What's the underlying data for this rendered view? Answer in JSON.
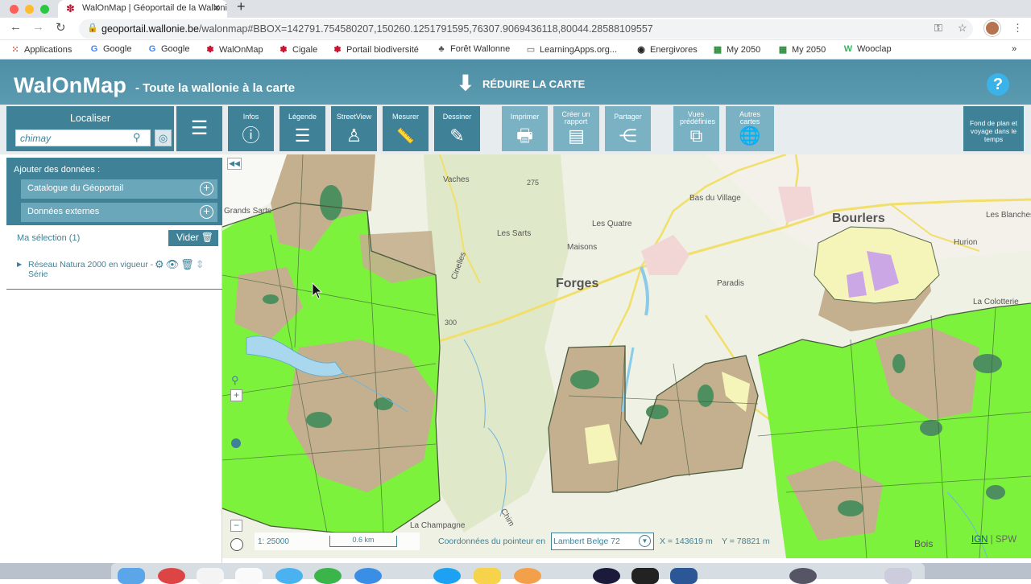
{
  "browser": {
    "tab_title": "WalOnMap | Géoportail de la Wallonie",
    "url_host": "geoportail.wallonie.be",
    "url_path": "/walonmap#BBOX=142791.754580207,150260.1251791595,76307.9069436118,80044.28588109557",
    "bookmarks": [
      {
        "icon": "grid",
        "label": "Applications"
      },
      {
        "icon": "G",
        "label": "Google"
      },
      {
        "icon": "G",
        "label": "Google"
      },
      {
        "icon": "dragon",
        "label": "WalOnMap"
      },
      {
        "icon": "dragon",
        "label": "Cigale"
      },
      {
        "icon": "dragon",
        "label": "Portail biodiversité"
      },
      {
        "icon": "tree",
        "label": "Forêt Wallonne"
      },
      {
        "icon": "doc",
        "label": "LearningApps.org..."
      },
      {
        "icon": "globe",
        "label": "Energivores"
      },
      {
        "icon": "grid2050",
        "label": "My 2050"
      },
      {
        "icon": "grid2050",
        "label": "My 2050"
      },
      {
        "icon": "W",
        "label": "Wooclap"
      }
    ],
    "bookmarks_more": "»"
  },
  "app": {
    "logo": "WalOnMap",
    "logo_sub": "- Toute la wallonie à la carte",
    "reduce_label": "RÉDUIRE LA CARTE",
    "help_label": "?"
  },
  "toolbar": {
    "localiser_title": "Localiser",
    "search_value": "chimay",
    "buttons": [
      {
        "id": "infos",
        "label": "Infos",
        "icon": "ⓘ"
      },
      {
        "id": "legende",
        "label": "Légende",
        "icon": "☰"
      },
      {
        "id": "streetview",
        "label": "StreetView",
        "icon": "♙"
      },
      {
        "id": "mesurer",
        "label": "Mesurer",
        "icon": "📏"
      },
      {
        "id": "dessiner",
        "label": "Dessiner",
        "icon": "✎"
      },
      {
        "id": "imprimer",
        "label": "Imprimer",
        "icon": "🖶"
      },
      {
        "id": "rapport",
        "label": "Créer un rapport",
        "icon": "▤"
      },
      {
        "id": "partager",
        "label": "Partager",
        "icon": "⋲"
      },
      {
        "id": "vues",
        "label": "Vues prédéfinies",
        "icon": "⧉"
      },
      {
        "id": "autres",
        "label": "Autres cartes",
        "icon": "🌐"
      }
    ],
    "fond_label": "Fond de plan et voyage dans le temps"
  },
  "panel": {
    "add_title": "Ajouter des données :",
    "catalogue": "Catalogue du Géoportail",
    "externes": "Données externes",
    "selection": "Ma sélection (1)",
    "vider": "Vider",
    "layer_name": "Réseau Natura 2000 en vigueur - Série"
  },
  "map": {
    "labels": {
      "vaches": "Vaches",
      "bas_du_village": "Bas du Village",
      "grands_sarts": "Grands Sarts",
      "les_quatre_maisons_1": "Les Quatre",
      "les_quatre_maisons_2": "Maisons",
      "les_sarts": "Les Sarts",
      "bourlers": "Bourlers",
      "les_blanches": "Les Blanches",
      "hurion": "Hurion",
      "forges": "Forges",
      "paradis": "Paradis",
      "la_colotterie": "La Colotterie",
      "alt_275": "275",
      "alt_300": "300",
      "cinelles": "Cinelles",
      "la_champagne": "La Champagne",
      "bois": "Bois",
      "chim": "Chim"
    },
    "scale": "1: 25000",
    "scalebar": "0.6 km",
    "coord_label": "Coordonnées du pointeur en",
    "coord_system": "Lambert Belge 72",
    "x_label": "X =",
    "x_value": "143619 m",
    "y_label": "Y =",
    "y_value": "78821 m",
    "attrib_ign": "IGN",
    "attrib_sep": "|",
    "attrib_spw": "SPW"
  },
  "colors": {
    "accent": "#3f8298",
    "natura_green": "#7cf23c",
    "forest_tan": "#c4b08f",
    "lake_blue": "#a9d8ee"
  }
}
